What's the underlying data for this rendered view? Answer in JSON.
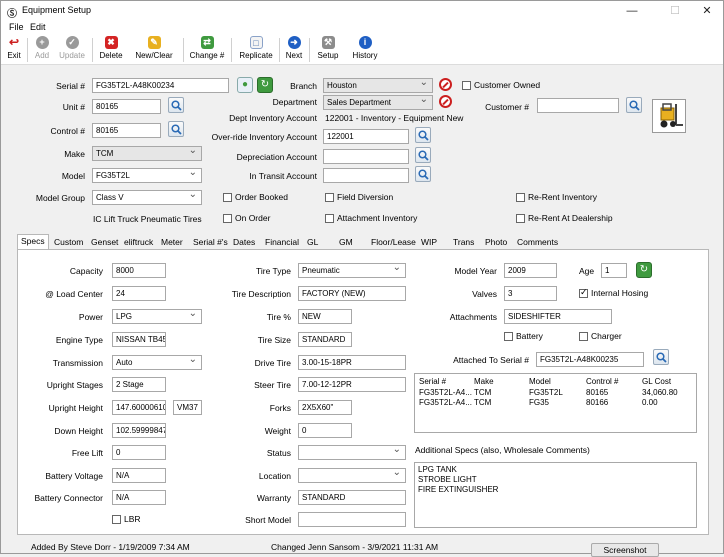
{
  "window": {
    "title": "Equipment Setup",
    "minimize": "—",
    "maximize": "☐",
    "close": "✕"
  },
  "menu": {
    "file": "File",
    "edit": "Edit"
  },
  "toolbar": {
    "exit": "Exit",
    "add": "Add",
    "update": "Update",
    "delete": "Delete",
    "new_clear": "New/Clear",
    "change": "Change #",
    "replicate": "Replicate",
    "next": "Next",
    "setup": "Setup",
    "history": "History"
  },
  "header": {
    "serial_label": "Serial #",
    "serial_value": "FG35T2L-A48K00234",
    "unit_label": "Unit #",
    "unit_value": "80165",
    "control_label": "Control #",
    "control_value": "80165",
    "make_label": "Make",
    "make_value": "TCM",
    "model_label": "Model",
    "model_value": "FG35T2L",
    "model_group_label": "Model Group",
    "model_group_value": "Class V",
    "model_desc": "IC Lift Truck Pneumatic Tires",
    "branch_label": "Branch",
    "branch_value": "Houston",
    "department_label": "Department",
    "department_value": "Sales Department",
    "dept_inv_label": "Dept Inventory Account",
    "dept_inv_value": "122001 - Inventory - Equipment New",
    "override_label": "Over-ride Inventory Account",
    "override_value": "122001",
    "depreciation_label": "Depreciation Account",
    "depreciation_value": "",
    "in_transit_label": "In Transit Account",
    "in_transit_value": "",
    "customer_owned": "Customer Owned",
    "customer_label": "Customer #",
    "customer_value": "",
    "order_booked": "Order Booked",
    "on_order": "On Order",
    "field_diversion": "Field Diversion",
    "attachment_inventory": "Attachment Inventory",
    "re_rent_inventory": "Re-Rent Inventory",
    "re_rent_dealership": "Re-Rent At Dealership"
  },
  "tabs": [
    "Specs",
    "Custom",
    "Genset",
    "eliftruck",
    "Meter",
    "Serial #'s",
    "Dates",
    "Financial",
    "GL",
    "GM",
    "Floor/Lease",
    "WIP",
    "Trans",
    "Photo",
    "Comments"
  ],
  "specs": {
    "capacity_label": "Capacity",
    "capacity": "8000",
    "load_center_label": "@ Load Center",
    "load_center": "24",
    "power_label": "Power",
    "power": "LPG",
    "engine_label": "Engine Type",
    "engine": "NISSAN TB45",
    "transmission_label": "Transmission",
    "transmission": "Auto",
    "upright_stages_label": "Upright Stages",
    "upright_stages": "2 Stage",
    "upright_height_label": "Upright Height",
    "upright_height": "147.600006103",
    "upright_code": "VM37",
    "down_height_label": "Down Height",
    "down_height": "102.59999847",
    "free_lift_label": "Free Lift",
    "free_lift": "0",
    "battery_voltage_label": "Battery Voltage",
    "battery_voltage": "N/A",
    "battery_connector_label": "Battery Connector",
    "battery_connector": "N/A",
    "lbr_label": "LBR",
    "tire_type_label": "Tire Type",
    "tire_type": "Pneumatic",
    "tire_desc_label": "Tire Description",
    "tire_desc": "FACTORY (NEW)",
    "tire_pct_label": "Tire %",
    "tire_pct": "NEW",
    "tire_size_label": "Tire Size",
    "tire_size": "STANDARD",
    "drive_tire_label": "Drive Tire",
    "drive_tire": "3.00-15-18PR",
    "steer_tire_label": "Steer Tire",
    "steer_tire": "7.00-12-12PR",
    "forks_label": "Forks",
    "forks": "2X5X60\"",
    "weight_label": "Weight",
    "weight": "0",
    "status_label": "Status",
    "status": "",
    "location_label": "Location",
    "location": "",
    "warranty_label": "Warranty",
    "warranty": "STANDARD",
    "short_model_label": "Short Model",
    "short_model": "",
    "model_year_label": "Model Year",
    "model_year": "2009",
    "age_label": "Age",
    "age": "1",
    "valves_label": "Valves",
    "valves": "3",
    "internal_hosing": "Internal Hosing",
    "attachments_label": "Attachments",
    "attachments": "SIDESHIFTER",
    "battery_label": "Battery",
    "charger_label": "Charger",
    "attached_to_label": "Attached To Serial #",
    "attached_to": "FG35T2L-A48K00235",
    "additional_specs_label": "Additional Specs (also, Wholesale Comments)",
    "additional_specs": [
      "LPG TANK",
      "STROBE LIGHT",
      "FIRE EXTINGUISHER"
    ]
  },
  "serial_grid": {
    "headers": [
      "Serial #",
      "Make",
      "Model",
      "Control #",
      "GL Cost"
    ],
    "rows": [
      [
        "FG35T2L-A4...",
        "TCM",
        "FG35T2L",
        "80165",
        "34,060.80"
      ],
      [
        "FG35T2L-A4...",
        "TCM",
        "FG35",
        "80166",
        "0.00"
      ]
    ]
  },
  "status_bar": {
    "added": "Added By   Steve Dorr - 1/19/2009 7:34 AM",
    "changed": "Changed   Jenn Sansom - 3/9/2021 11:31 AM",
    "screenshot": "Screenshot"
  },
  "colors": {
    "accent_red": "#cc1f1f",
    "accent_green": "#3f9a3f",
    "accent_blue": "#1f5fc4"
  }
}
